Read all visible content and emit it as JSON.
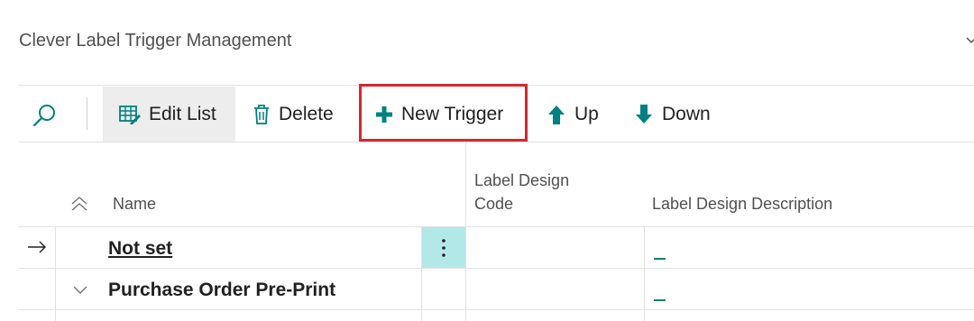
{
  "page": {
    "title": "Clever Label Trigger Management"
  },
  "toolbar": {
    "edit_list": "Edit List",
    "delete": "Delete",
    "new_trigger": "New Trigger",
    "up": "Up",
    "down": "Down"
  },
  "table": {
    "headers": {
      "name": "Name",
      "label_design_code_line1": "Label Design",
      "label_design_code_line2": "Code",
      "label_design_description": "Label Design Description"
    },
    "rows": [
      {
        "name": "Not set",
        "code": "",
        "description": "_"
      },
      {
        "name": "Purchase Order Pre-Print",
        "code": "",
        "description": "_"
      }
    ]
  },
  "colors": {
    "accent": "#008080",
    "highlight": "#d7262e",
    "selected_cell": "#b3e8e8"
  }
}
